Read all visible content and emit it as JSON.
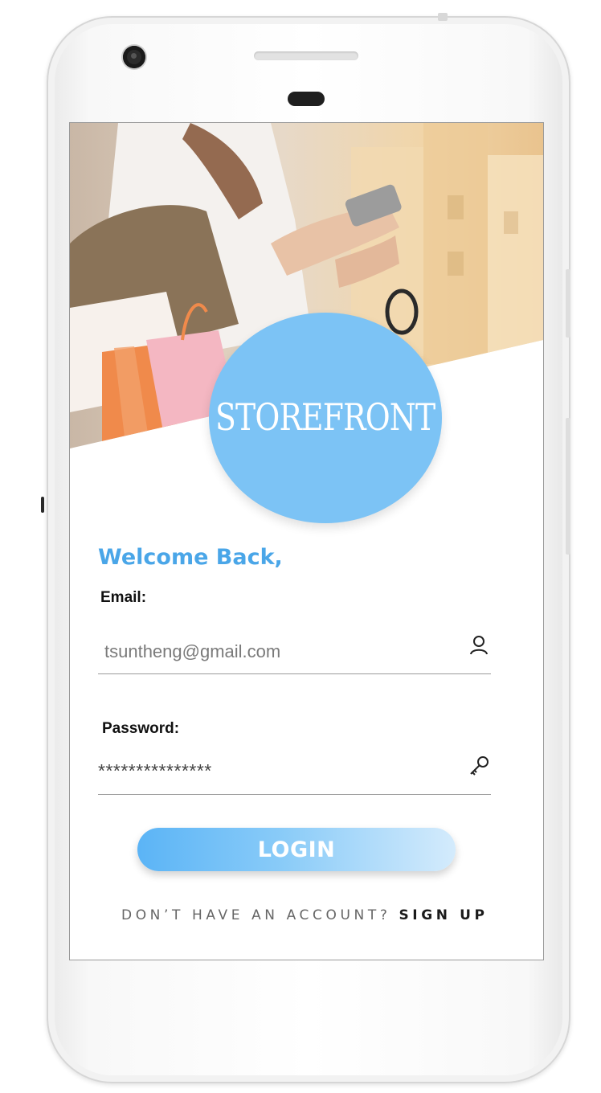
{
  "app": {
    "logo_text": "STOREFRONT",
    "brand_color": "#7cc3f5"
  },
  "login": {
    "welcome": "Welcome Back,",
    "email_label": "Email:",
    "email_value": "tsuntheng@gmail.com",
    "email_icon": "user-icon",
    "password_label": "Password:",
    "password_value": "***************",
    "password_icon": "key-icon",
    "login_button": "LOGIN",
    "signup_prompt": "DON’T HAVE AN ACCOUNT?",
    "signup_link": "SIGN UP",
    "accent_color": "#4aa6e8"
  }
}
